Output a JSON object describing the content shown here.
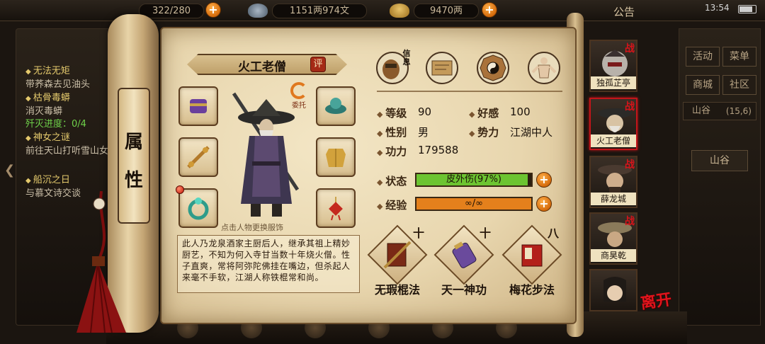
{
  "topbar": {
    "stamina": "322/280",
    "money": "1151两974文",
    "gold": "9470两",
    "notice": "公告",
    "time": "13:54"
  },
  "quests": [
    {
      "title": "无法无矩",
      "desc": "带荞森去见油头"
    },
    {
      "title": "枯骨毒蟒",
      "desc": "消灭毒蟒",
      "progress": "歼灭进度：0/4"
    },
    {
      "title": "神女之谜",
      "desc": "前往天山打听雪山女"
    },
    {
      "title": "船沉之日",
      "desc": "与慕文诗交谈"
    }
  ],
  "right_menu": {
    "buttons": [
      "活动",
      "菜单",
      "商城",
      "社区"
    ],
    "location": "山谷",
    "location_coord": "(15,6)",
    "location_button": "山谷"
  },
  "scroll": {
    "tab_chars": [
      "属",
      "性"
    ]
  },
  "npc": {
    "name": "火工老僧",
    "eval_label": "评",
    "entrust_label": "委托",
    "hint": "点击人物更换服饰",
    "bio": "此人乃龙泉酒家主厨后人，继承其祖上精妙厨艺，不知为何入寺甘当数十年烧火僧。性子直爽，常将阿弥陀佛挂在嘴边，但杀起人来毫不手软，江湖人称铁棍常和尚。",
    "top_icon_badge": "信息"
  },
  "stats": {
    "level_label": "等级",
    "level": "90",
    "favor_label": "好感",
    "favor": "100",
    "gender_label": "性别",
    "gender": "男",
    "faction_label": "势力",
    "faction": "江湖中人",
    "power_label": "功力",
    "power": "179588",
    "status_label": "状态",
    "status_text": "皮外伤(97%)",
    "status_fraction": 0.97,
    "exp_label": "经验",
    "exp_text": "∞/∞",
    "exp_fraction": 1.0
  },
  "skills": [
    {
      "name": "无瑕棍法",
      "level": "十"
    },
    {
      "name": "天一神功",
      "level": "十"
    },
    {
      "name": "梅花步法",
      "level": "八"
    }
  ],
  "companions": [
    {
      "name": "独孤芷亭",
      "badge": "战"
    },
    {
      "name": "火工老僧",
      "badge": "战"
    },
    {
      "name": "薛龙城",
      "badge": "战"
    },
    {
      "name": "商昊乾",
      "badge": "战"
    },
    {
      "name": ""
    }
  ],
  "leave_label": "离开",
  "colors": {
    "status_fill": "#6cc431",
    "exp_fill": "#e4801c",
    "active_border": "#c2151a"
  }
}
